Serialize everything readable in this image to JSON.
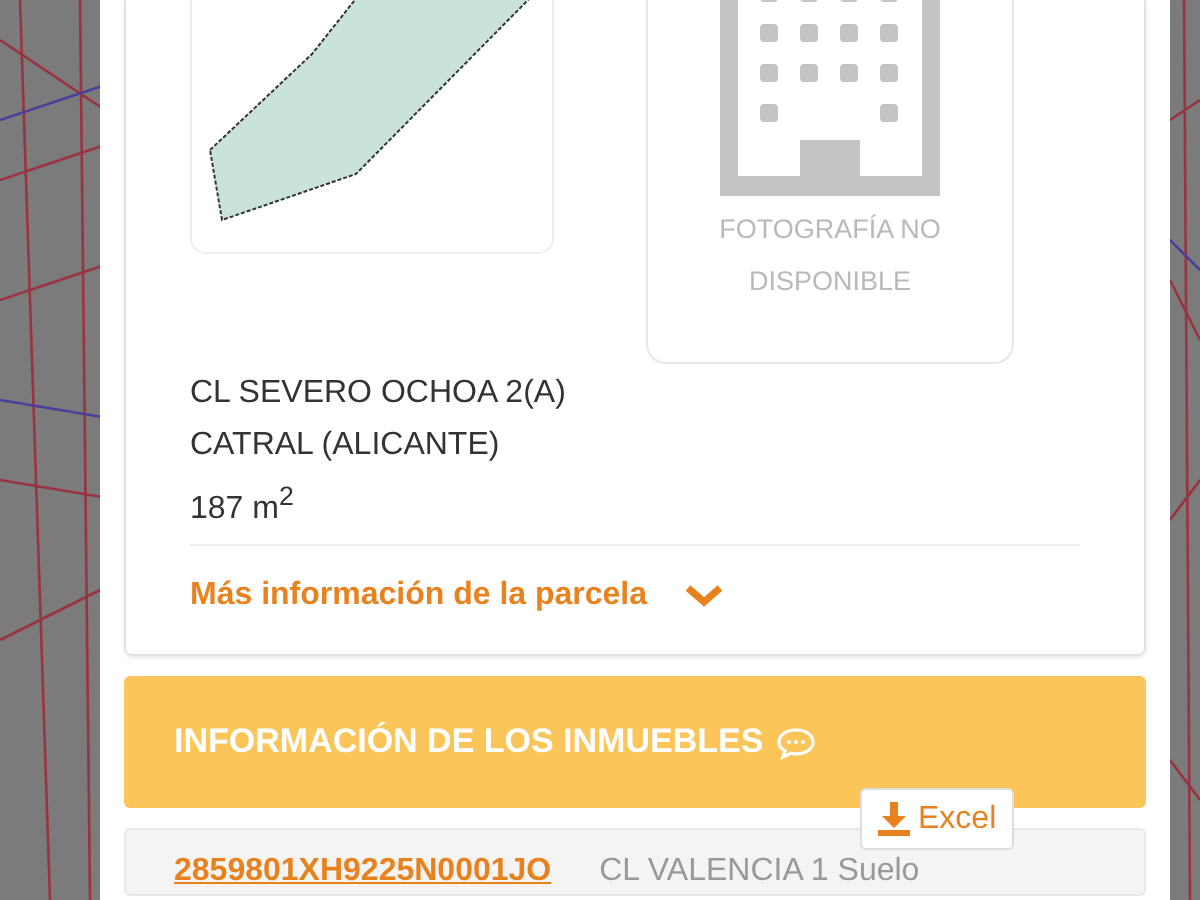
{
  "parcel": {
    "address_lines": [
      "CL SEVERO OCHOA 2(A)",
      "CATRAL (ALICANTE)"
    ],
    "area": "187 m$^{2}$",
    "photo_placeholder": "FOTOGRAFÍA NO DISPONIBLE",
    "more_info_link": "Más información de la parcela",
    "expanded": false
  },
  "properties": {
    "title": "INFORMACIÓN DE LOS INMUEBLES",
    "excel_button": "Excel",
    "rows": [
      {
        "reference": "2859801XH9225N0001JO",
        "address": "CL VALENCIA 1 Suelo"
      }
    ]
  }
}
